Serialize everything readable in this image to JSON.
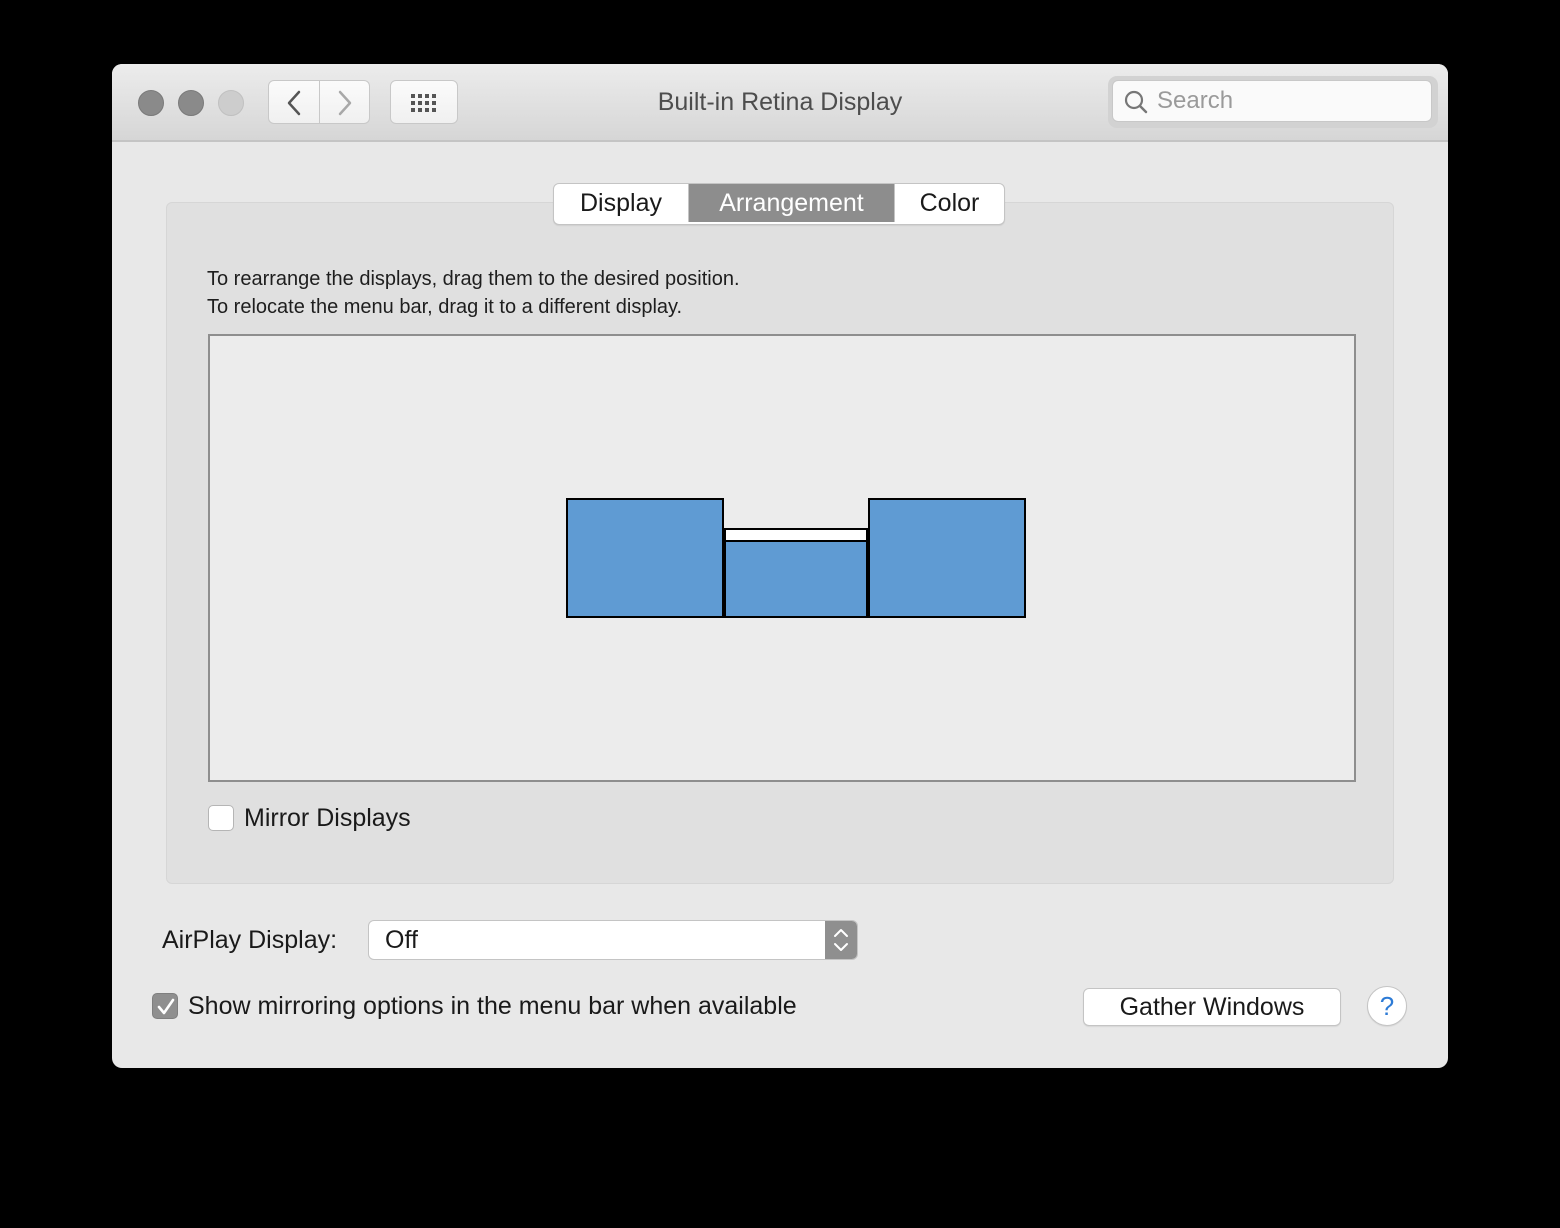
{
  "window": {
    "title": "Built-in Retina Display"
  },
  "toolbar": {
    "search_placeholder": "Search"
  },
  "tabs": [
    {
      "label": "Display",
      "selected": false
    },
    {
      "label": "Arrangement",
      "selected": true
    },
    {
      "label": "Color",
      "selected": false
    }
  ],
  "arrangement": {
    "instruction_1": "To rearrange the displays, drag them to the desired position.",
    "instruction_2": "To relocate the menu bar, drag it to a different display.",
    "display_color": "#5f9bd3"
  },
  "mirror": {
    "label": "Mirror Displays",
    "checked": false
  },
  "airplay": {
    "label": "AirPlay Display:",
    "value": "Off"
  },
  "show_mirroring": {
    "label": "Show mirroring options in the menu bar when available",
    "checked": true
  },
  "buttons": {
    "gather_windows": "Gather Windows",
    "help": "?"
  }
}
